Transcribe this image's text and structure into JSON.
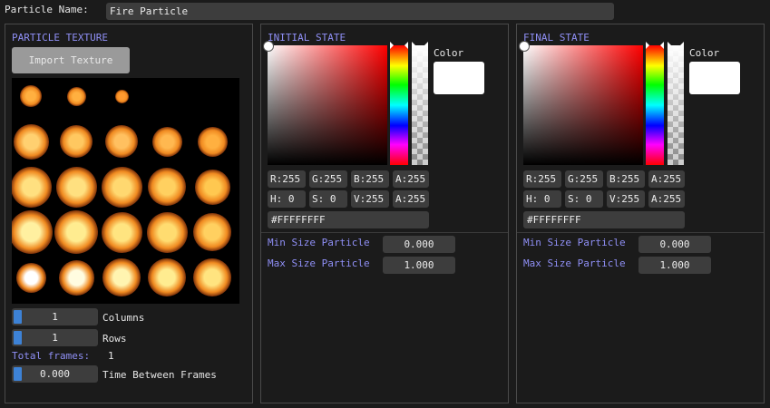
{
  "header": {
    "name_label": "Particle Name:",
    "name_value": "Fire Particle"
  },
  "texture_panel": {
    "title": "PARTICLE TEXTURE",
    "import_button": "Import Texture",
    "columns": {
      "value": "1",
      "label": "Columns"
    },
    "rows": {
      "value": "1",
      "label": "Rows"
    },
    "total_frames_label": "Total frames:",
    "total_frames_value": "1",
    "time_between": {
      "value": "0.000",
      "label": "Time Between Frames"
    }
  },
  "initial_state": {
    "title": "INITIAL STATE",
    "color_label": "Color",
    "r": "R:255",
    "g": "G:255",
    "b": "B:255",
    "a": "A:255",
    "h": "H:  0",
    "s": "S:  0",
    "v": "V:255",
    "a2": "A:255",
    "hex": "#FFFFFFFF",
    "min_size_label": "Min Size Particle",
    "min_size_value": "0.000",
    "max_size_label": "Max Size Particle",
    "max_size_value": "1.000"
  },
  "final_state": {
    "title": "FINAL STATE",
    "color_label": "Color",
    "r": "R:255",
    "g": "G:255",
    "b": "B:255",
    "a": "A:255",
    "h": "H:  0",
    "s": "S:  0",
    "v": "V:255",
    "a2": "A:255",
    "hex": "#FFFFFFFF",
    "min_size_label": "Min Size Particle",
    "min_size_value": "0.000",
    "max_size_label": "Max Size Particle",
    "max_size_value": "1.000"
  },
  "colors": {
    "accent_text": "#8f8ff5",
    "slider_grab": "#3d82d6",
    "frame_bg": "#3d3d3d",
    "window_bg": "#1b1b1b"
  }
}
